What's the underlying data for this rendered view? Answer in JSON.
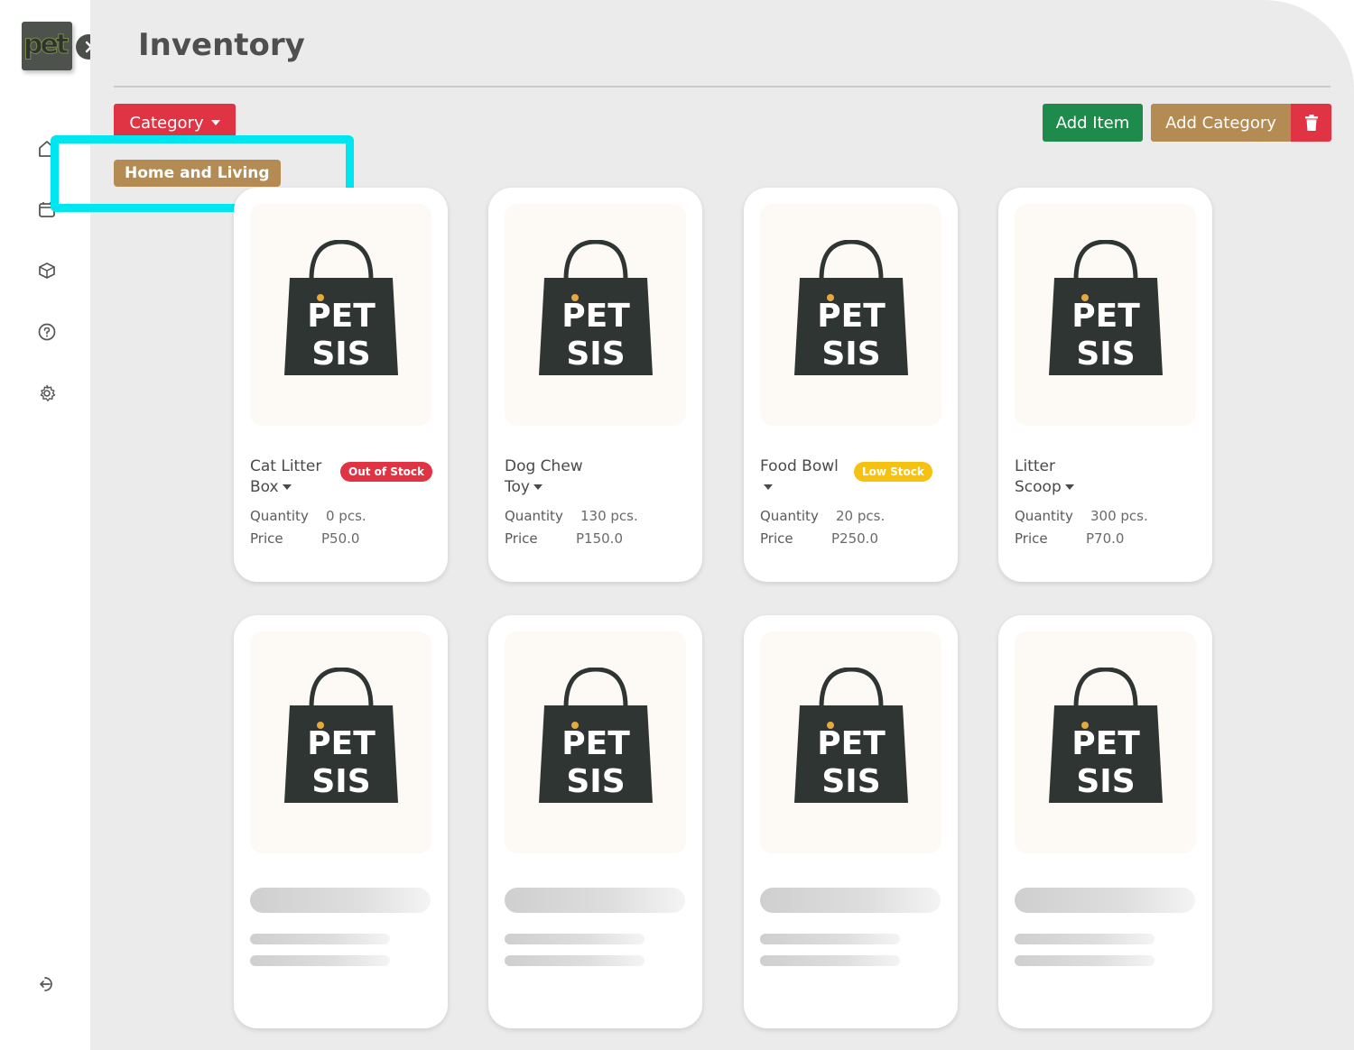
{
  "app": {
    "logo_text": "pet",
    "page_title": "Inventory"
  },
  "sidebar": {
    "icons": [
      "home-icon",
      "calendar-icon",
      "box-icon",
      "help-icon",
      "settings-icon",
      "logout-icon"
    ]
  },
  "toolbar": {
    "category_label": "Category",
    "add_item_label": "Add Item",
    "add_category_label": "Add Category"
  },
  "filter": {
    "selected_category": "Home and Living"
  },
  "brand": {
    "bag_line1": "PET",
    "bag_line2": "SIS"
  },
  "colors": {
    "red": "#e03444",
    "green": "#1e8a4c",
    "tan": "#b48b52",
    "yellow": "#f5c211",
    "highlight": "#00e6f0"
  },
  "labels": {
    "quantity": "Quantity",
    "price": "Price"
  },
  "products": [
    {
      "name_line1": "Cat Litter",
      "name_line2": "Box",
      "badge": "Out of Stock",
      "quantity": "0 pcs.",
      "price": "P50.0"
    },
    {
      "name_line1": "Dog Chew",
      "name_line2": "Toy",
      "badge": "",
      "quantity": "130 pcs.",
      "price": "P150.0"
    },
    {
      "name_line1": "Food Bowl",
      "name_line2": "",
      "badge": "Low Stock",
      "quantity": "20 pcs.",
      "price": "P250.0"
    },
    {
      "name_line1": "Litter",
      "name_line2": "Scoop",
      "badge": "",
      "quantity": "300 pcs.",
      "price": "P70.0"
    }
  ]
}
